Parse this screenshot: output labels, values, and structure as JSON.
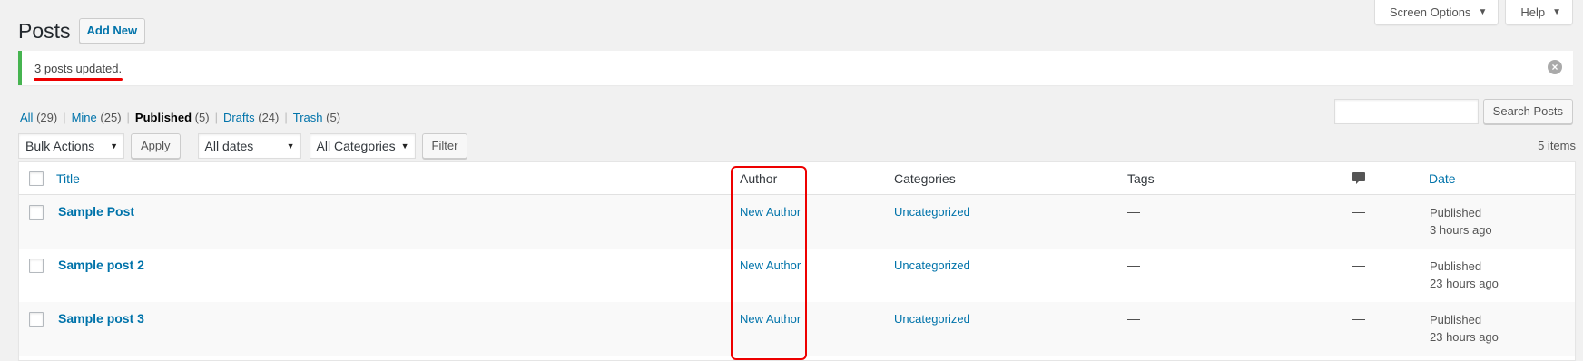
{
  "header": {
    "title": "Posts",
    "add_new_label": "Add New",
    "screen_options_label": "Screen Options",
    "help_label": "Help"
  },
  "notice": {
    "message": "3 posts updated."
  },
  "views": [
    {
      "label": "All",
      "count": "(29)"
    },
    {
      "label": "Mine",
      "count": "(25)"
    },
    {
      "label": "Published",
      "count": "(5)"
    },
    {
      "label": "Drafts",
      "count": "(24)"
    },
    {
      "label": "Trash",
      "count": "(5)"
    }
  ],
  "search": {
    "value": "",
    "button_label": "Search Posts"
  },
  "tablenav": {
    "bulk_actions": "Bulk Actions",
    "apply_label": "Apply",
    "dates": "All dates",
    "categories": "All Categories",
    "filter_label": "Filter",
    "items_count": "5 items"
  },
  "table": {
    "headers": {
      "title": "Title",
      "author": "Author",
      "categories": "Categories",
      "tags": "Tags",
      "date": "Date"
    },
    "rows": [
      {
        "title": "Sample Post",
        "author": "New Author",
        "category": "Uncategorized",
        "tags": "—",
        "comments": "—",
        "status": "Published",
        "time": "3 hours ago"
      },
      {
        "title": "Sample post 2",
        "author": "New Author",
        "category": "Uncategorized",
        "tags": "—",
        "comments": "—",
        "status": "Published",
        "time": "23 hours ago"
      },
      {
        "title": "Sample post 3",
        "author": "New Author",
        "category": "Uncategorized",
        "tags": "—",
        "comments": "—",
        "status": "Published",
        "time": "23 hours ago"
      }
    ]
  },
  "colors": {
    "link": "#0073aa",
    "success": "#46b450",
    "annotation": "#ee0000"
  }
}
